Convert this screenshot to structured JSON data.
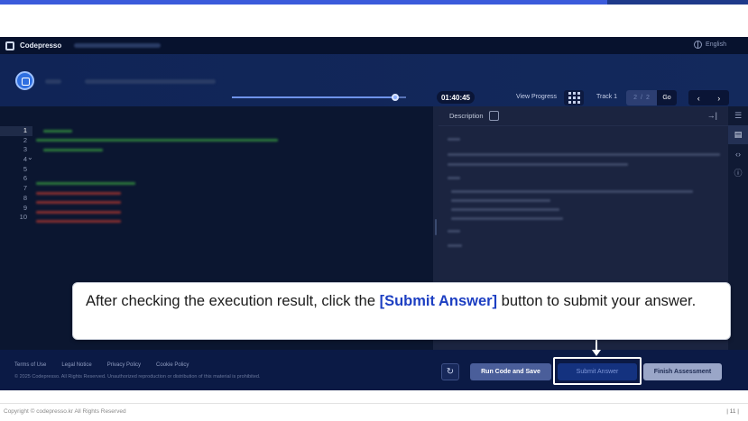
{
  "app": {
    "brand": "Codepresso",
    "language": "English"
  },
  "header": {
    "timer": "01:40:45",
    "progress_fraction": 0.94,
    "view_progress_label": "View Progress",
    "track_label": "Track 1",
    "page_current": "2",
    "page_sep": "/",
    "page_total": "2",
    "go_label": "Go",
    "prev_label": "‹",
    "next_label": "›"
  },
  "editor": {
    "line_numbers": [
      "1",
      "2",
      "3",
      "4",
      "5",
      "6",
      "7",
      "8",
      "9",
      "10"
    ],
    "fold_marker": "⌄"
  },
  "description": {
    "tab_label": "Description",
    "collapse_label": "→|"
  },
  "footer": {
    "links": [
      "Terms of Use",
      "Legal Notice",
      "Privacy Policy",
      "Cookie Policy"
    ],
    "copyright": "© 2025 Codepresso. All Rights Reserved. Unauthorized reproduction or distribution of this material is prohibited.",
    "run_label": "Run Code and Save",
    "submit_label": "Submit Answer",
    "finish_label": "Finish Assessment"
  },
  "callout": {
    "before": "After checking the execution result, click the ",
    "highlight": "[Submit Answer]",
    "after": " button to submit your answer."
  },
  "page_footer": {
    "copyright": "Copyright © codepresso.kr All Rights Reserved",
    "page_number": "| 11 |"
  },
  "colors": {
    "accent": "#3b5bdb",
    "app_background": "#0d1b3e",
    "callout_highlight": "#1d3fc2"
  }
}
